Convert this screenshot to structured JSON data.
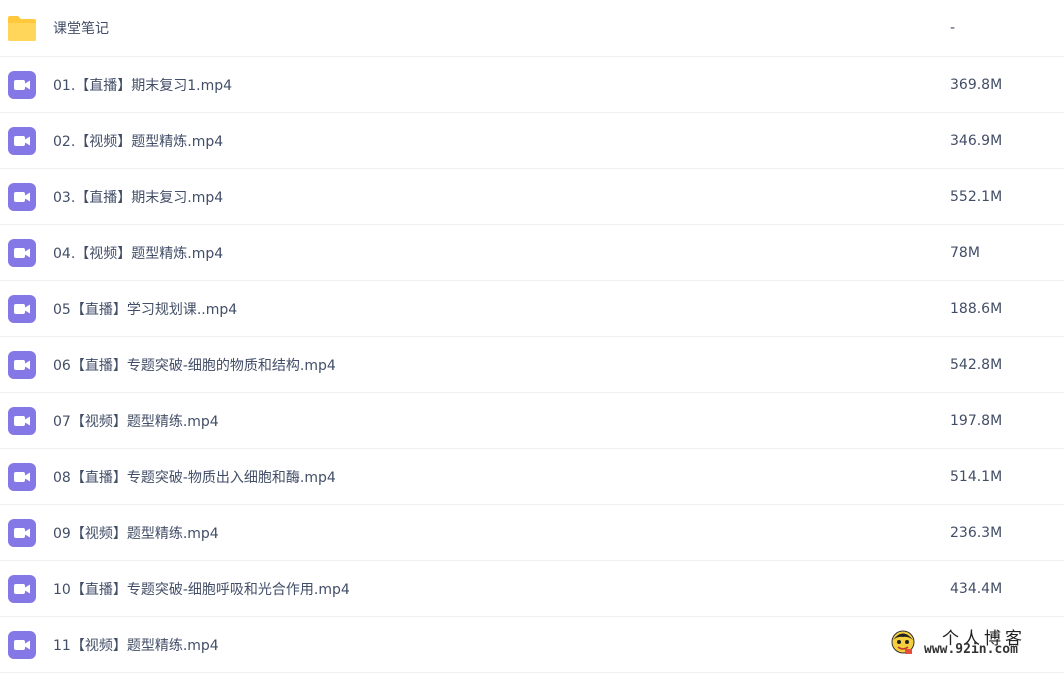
{
  "files": [
    {
      "type": "folder",
      "icon": "folder-icon",
      "name": "课堂笔记",
      "size": "-"
    },
    {
      "type": "video",
      "icon": "video-file-icon",
      "name": "01.【直播】期末复习1.mp4",
      "size": "369.8M"
    },
    {
      "type": "video",
      "icon": "video-file-icon",
      "name": "02.【视频】题型精炼.mp4",
      "size": "346.9M"
    },
    {
      "type": "video",
      "icon": "video-file-icon",
      "name": "03.【直播】期末复习.mp4",
      "size": "552.1M"
    },
    {
      "type": "video",
      "icon": "video-file-icon",
      "name": "04.【视频】题型精炼.mp4",
      "size": "78M"
    },
    {
      "type": "video",
      "icon": "video-file-icon",
      "name": "05【直播】学习规划课..mp4",
      "size": "188.6M"
    },
    {
      "type": "video",
      "icon": "video-file-icon",
      "name": "06【直播】专题突破-细胞的物质和结构.mp4",
      "size": "542.8M"
    },
    {
      "type": "video",
      "icon": "video-file-icon",
      "name": "07【视频】题型精练.mp4",
      "size": "197.8M"
    },
    {
      "type": "video",
      "icon": "video-file-icon",
      "name": "08【直播】专题突破-物质出入细胞和酶.mp4",
      "size": "514.1M"
    },
    {
      "type": "video",
      "icon": "video-file-icon",
      "name": "09【视频】题型精练.mp4",
      "size": "236.3M"
    },
    {
      "type": "video",
      "icon": "video-file-icon",
      "name": "10【直播】专题突破-细胞呼吸和光合作用.mp4",
      "size": "434.4M"
    },
    {
      "type": "video",
      "icon": "video-file-icon",
      "name": "11【视频】题型精练.mp4",
      "size": ""
    }
  ],
  "colors": {
    "folder": "#ffc83d",
    "video": "#8477e6",
    "text": "#424e67"
  },
  "watermark": {
    "title": "个人博客",
    "url": "www.92in.com",
    "icon": "mascot-logo-icon"
  }
}
